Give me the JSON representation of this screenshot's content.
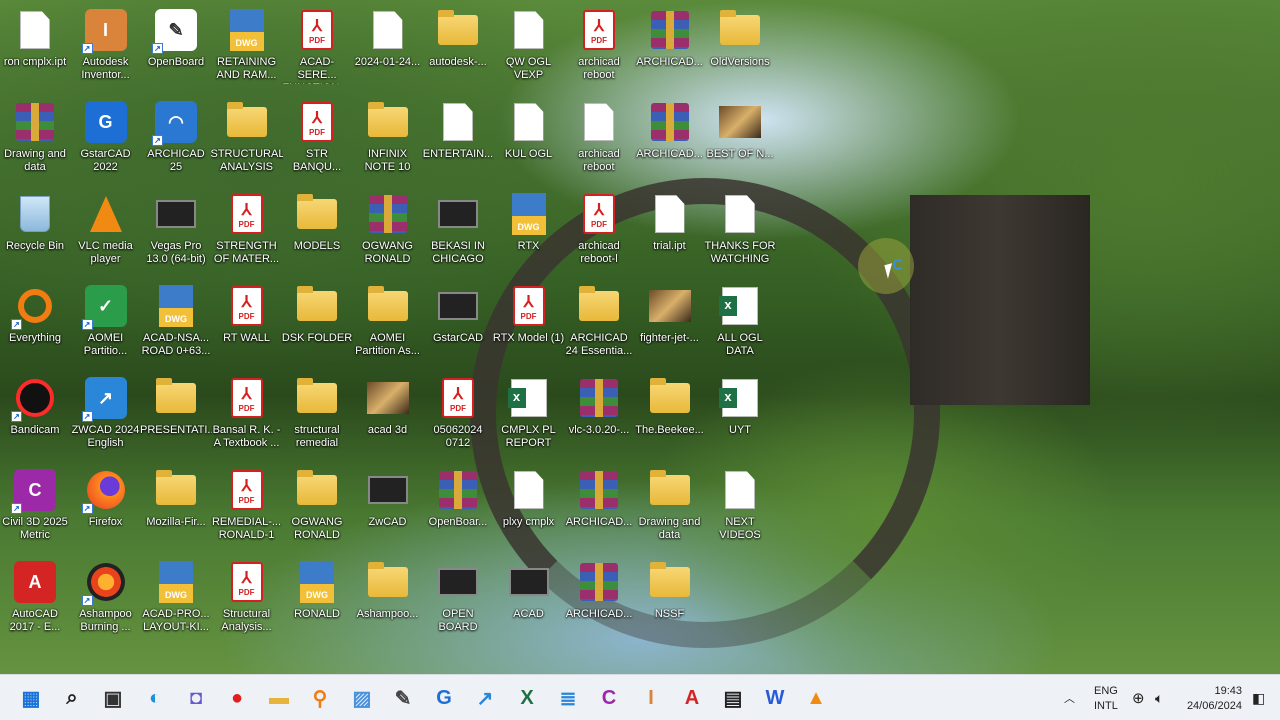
{
  "desktop": {
    "icons": [
      {
        "label": "ron cmplx.ipt",
        "type": "file",
        "col": 0,
        "row": 0
      },
      {
        "label": "Autodesk Inventor...",
        "type": "app",
        "glyph": "I",
        "color": "#d9843a",
        "shortcut": true,
        "col": 1,
        "row": 0
      },
      {
        "label": "OpenBoard",
        "type": "app",
        "glyph": "✎",
        "color": "#ffffff",
        "shortcut": true,
        "col": 2,
        "row": 0
      },
      {
        "label": "RETAINING AND RAM...",
        "type": "dwg",
        "col": 3,
        "row": 0
      },
      {
        "label": "ACAD-SERE... FUNCTION ...",
        "type": "pdf",
        "col": 4,
        "row": 0
      },
      {
        "label": "2024-01-24...",
        "type": "file",
        "col": 5,
        "row": 0
      },
      {
        "label": "autodesk-...",
        "type": "folder",
        "col": 6,
        "row": 0
      },
      {
        "label": "QW OGL VEXP",
        "type": "file",
        "col": 7,
        "row": 0
      },
      {
        "label": "archicad reboot",
        "type": "pdf",
        "col": 8,
        "row": 0
      },
      {
        "label": "ARCHICAD...",
        "type": "rar",
        "col": 9,
        "row": 0
      },
      {
        "label": "OldVersions",
        "type": "folder",
        "col": 10,
        "row": 0
      },
      {
        "label": "Drawing and data",
        "type": "rar",
        "col": 0,
        "row": 1
      },
      {
        "label": "GstarCAD 2022",
        "type": "app",
        "glyph": "G",
        "color": "#1d6fd6",
        "col": 1,
        "row": 1
      },
      {
        "label": "ARCHICAD 25",
        "type": "app",
        "glyph": "◠",
        "color": "#2a78d2",
        "shortcut": true,
        "col": 2,
        "row": 1
      },
      {
        "label": "STRUCTURAL ANALYSIS",
        "type": "folder",
        "col": 3,
        "row": 1
      },
      {
        "label": "STR BANQU...",
        "type": "pdf",
        "col": 4,
        "row": 1
      },
      {
        "label": "INFINIX NOTE 10",
        "type": "folder",
        "col": 5,
        "row": 1
      },
      {
        "label": "ENTERTAIN...",
        "type": "file",
        "col": 6,
        "row": 1
      },
      {
        "label": "KUL OGL",
        "type": "file",
        "col": 7,
        "row": 1
      },
      {
        "label": "archicad reboot",
        "type": "file",
        "col": 8,
        "row": 1
      },
      {
        "label": "ARCHICAD...",
        "type": "rar",
        "col": 9,
        "row": 1
      },
      {
        "label": "BEST OF N...",
        "type": "img",
        "col": 10,
        "row": 1
      },
      {
        "label": "Recycle Bin",
        "type": "bin",
        "col": 0,
        "row": 2
      },
      {
        "label": "VLC media player",
        "type": "cone",
        "col": 1,
        "row": 2
      },
      {
        "label": "Vegas Pro 13.0 (64-bit)",
        "type": "dark",
        "col": 2,
        "row": 2
      },
      {
        "label": "STRENGTH OF MATER...",
        "type": "pdf",
        "col": 3,
        "row": 2
      },
      {
        "label": "MODELS",
        "type": "folder",
        "col": 4,
        "row": 2
      },
      {
        "label": "OGWANG RONALD",
        "type": "rar",
        "col": 5,
        "row": 2
      },
      {
        "label": "BEKASI IN CHICAGO",
        "type": "dark",
        "col": 6,
        "row": 2
      },
      {
        "label": "RTX",
        "type": "dwg",
        "col": 7,
        "row": 2
      },
      {
        "label": "archicad reboot-l",
        "type": "pdf",
        "col": 8,
        "row": 2
      },
      {
        "label": "trial.ipt",
        "type": "file",
        "col": 9,
        "row": 2
      },
      {
        "label": "THANKS FOR WATCHING",
        "type": "file",
        "col": 10,
        "row": 2
      },
      {
        "label": "Everything",
        "type": "ring",
        "shortcut": true,
        "col": 0,
        "row": 3
      },
      {
        "label": "AOMEI Partitio...",
        "type": "app",
        "glyph": "✓",
        "color": "#2a9c4a",
        "shortcut": true,
        "col": 1,
        "row": 3
      },
      {
        "label": "ACAD-NSA... ROAD 0+63...",
        "type": "dwg",
        "col": 2,
        "row": 3
      },
      {
        "label": "RT WALL",
        "type": "pdf",
        "col": 3,
        "row": 3
      },
      {
        "label": "DSK FOLDER",
        "type": "folder",
        "col": 4,
        "row": 3
      },
      {
        "label": "AOMEI Partition As...",
        "type": "folder",
        "col": 5,
        "row": 3
      },
      {
        "label": "GstarCAD",
        "type": "dark",
        "col": 6,
        "row": 3
      },
      {
        "label": "RTX Model (1)",
        "type": "pdf",
        "col": 7,
        "row": 3
      },
      {
        "label": "ARCHICAD 24 Essentia...",
        "type": "folder",
        "col": 8,
        "row": 3
      },
      {
        "label": "fighter-jet-...",
        "type": "img",
        "col": 9,
        "row": 3
      },
      {
        "label": "ALL OGL DATA",
        "type": "xls",
        "col": 10,
        "row": 3
      },
      {
        "label": "Bandicam",
        "type": "rec",
        "shortcut": true,
        "col": 0,
        "row": 4
      },
      {
        "label": "ZWCAD 2024 English",
        "type": "app",
        "glyph": "↗",
        "color": "#2a86d8",
        "shortcut": true,
        "col": 1,
        "row": 4
      },
      {
        "label": "PRESENTATI...",
        "type": "folder",
        "col": 2,
        "row": 4
      },
      {
        "label": "Bansal R. K. - A Textbook ...",
        "type": "pdf",
        "col": 3,
        "row": 4
      },
      {
        "label": "structural remedial",
        "type": "folder",
        "col": 4,
        "row": 4
      },
      {
        "label": "acad 3d",
        "type": "img",
        "col": 5,
        "row": 4
      },
      {
        "label": "05062024 0712",
        "type": "pdf",
        "col": 6,
        "row": 4
      },
      {
        "label": "CMPLX PL REPORT",
        "type": "xls",
        "col": 7,
        "row": 4
      },
      {
        "label": "vlc-3.0.20-...",
        "type": "rar",
        "col": 8,
        "row": 4
      },
      {
        "label": "The.Beekee...",
        "type": "folder",
        "col": 9,
        "row": 4
      },
      {
        "label": "UYT",
        "type": "xls",
        "col": 10,
        "row": 4
      },
      {
        "label": "Civil 3D 2025 Metric",
        "type": "app",
        "glyph": "C",
        "color": "#9c2aa8",
        "shortcut": true,
        "col": 0,
        "row": 5
      },
      {
        "label": "Firefox",
        "type": "fox",
        "shortcut": true,
        "col": 1,
        "row": 5
      },
      {
        "label": "Mozilla-Fir...",
        "type": "folder",
        "col": 2,
        "row": 5
      },
      {
        "label": "REMEDIAL-... RONALD-1",
        "type": "pdf",
        "col": 3,
        "row": 5
      },
      {
        "label": "OGWANG RONALD",
        "type": "folder",
        "col": 4,
        "row": 5
      },
      {
        "label": "ZwCAD",
        "type": "dark",
        "col": 5,
        "row": 5
      },
      {
        "label": "OpenBoar...",
        "type": "rar",
        "col": 6,
        "row": 5
      },
      {
        "label": "plxy cmplx",
        "type": "file",
        "col": 7,
        "row": 5
      },
      {
        "label": "ARCHICAD...",
        "type": "rar",
        "col": 8,
        "row": 5
      },
      {
        "label": "Drawing and data",
        "type": "folder",
        "col": 9,
        "row": 5
      },
      {
        "label": "NEXT VIDEOS",
        "type": "file",
        "col": 10,
        "row": 5
      },
      {
        "label": "AutoCAD 2017 - E...",
        "type": "app",
        "glyph": "A",
        "color": "#d42424",
        "col": 0,
        "row": 6
      },
      {
        "label": "Ashampoo Burning ...",
        "type": "flame",
        "shortcut": true,
        "col": 1,
        "row": 6
      },
      {
        "label": "ACAD-PRO... LAYOUT-KI...",
        "type": "dwg",
        "col": 2,
        "row": 6
      },
      {
        "label": "Structural Analysis...",
        "type": "pdf",
        "col": 3,
        "row": 6
      },
      {
        "label": "RONALD",
        "type": "dwg",
        "col": 4,
        "row": 6
      },
      {
        "label": "Ashampoo...",
        "type": "folder",
        "col": 5,
        "row": 6
      },
      {
        "label": "OPEN BOARD",
        "type": "dark",
        "col": 6,
        "row": 6
      },
      {
        "label": "ACAD",
        "type": "dark",
        "col": 7,
        "row": 6
      },
      {
        "label": "ARCHICAD...",
        "type": "rar",
        "col": 8,
        "row": 6
      },
      {
        "label": "NSSF",
        "type": "folder",
        "col": 9,
        "row": 6
      }
    ]
  },
  "badges": {
    "pdf": "PDF",
    "dwg": "DWG",
    "xls": "a"
  },
  "taskbar": {
    "items": [
      {
        "name": "start-button",
        "glyph": "▦",
        "color": "#1a73d9"
      },
      {
        "name": "search-button",
        "glyph": "⌕",
        "color": "#222"
      },
      {
        "name": "task-view-button",
        "glyph": "▣",
        "color": "#333"
      },
      {
        "name": "edge-button",
        "glyph": "◐",
        "color": "#1f8fd8"
      },
      {
        "name": "teams-button",
        "glyph": "◘",
        "color": "#6a5acd"
      },
      {
        "name": "bandicam-button",
        "glyph": "●",
        "color": "#e02020"
      },
      {
        "name": "file-explorer-button",
        "glyph": "▬",
        "color": "#e8b33a"
      },
      {
        "name": "everything-button",
        "glyph": "⚲",
        "color": "#f07c12"
      },
      {
        "name": "photos-button",
        "glyph": "▨",
        "color": "#4a90d9"
      },
      {
        "name": "openboard-button",
        "glyph": "✎",
        "color": "#444"
      },
      {
        "name": "gstarcad-button",
        "glyph": "G",
        "color": "#1d6fd6"
      },
      {
        "name": "zwcad-button",
        "glyph": "↗",
        "color": "#2a86d8"
      },
      {
        "name": "excel-button",
        "glyph": "X",
        "color": "#1e7145"
      },
      {
        "name": "notepad-button",
        "glyph": "≣",
        "color": "#2a86d8"
      },
      {
        "name": "civil3d-button",
        "glyph": "C",
        "color": "#9c2aa8"
      },
      {
        "name": "inventor-button",
        "glyph": "I",
        "color": "#d9843a"
      },
      {
        "name": "autocad-button",
        "glyph": "A",
        "color": "#d42424"
      },
      {
        "name": "vegas-button",
        "glyph": "▤",
        "color": "#222"
      },
      {
        "name": "word-button",
        "glyph": "W",
        "color": "#2a5bd7"
      },
      {
        "name": "vlc-button",
        "glyph": "▲",
        "color": "#f08a12"
      }
    ],
    "lang_line1": "ENG",
    "lang_line2": "INTL",
    "time": "19:43",
    "date": "24/06/2024"
  }
}
